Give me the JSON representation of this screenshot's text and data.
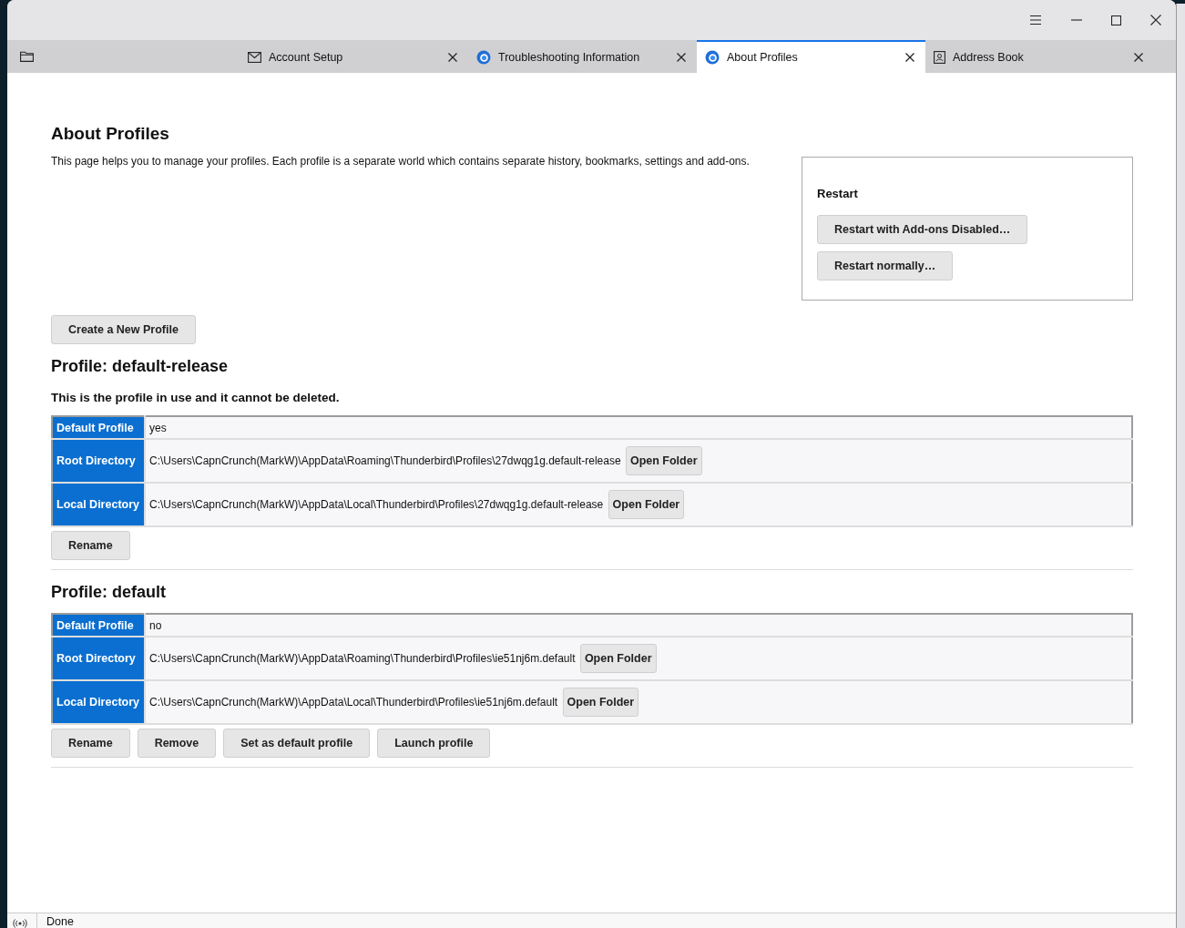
{
  "tabs": [
    {
      "label": "Account Setup",
      "kind": "mail",
      "selected": false
    },
    {
      "label": "Troubleshooting Information",
      "kind": "app",
      "selected": false
    },
    {
      "label": "About Profiles",
      "kind": "app",
      "selected": true
    },
    {
      "label": "Address Book",
      "kind": "contacts",
      "selected": false
    }
  ],
  "page": {
    "title": "About Profiles",
    "intro": "This page helps you to manage your profiles. Each profile is a separate world which contains separate history, bookmarks, settings and add-ons.",
    "restart": {
      "title": "Restart",
      "buttons": [
        "Restart with Add-ons Disabled…",
        "Restart normally…"
      ]
    },
    "create_button": "Create a New Profile",
    "profiles": [
      {
        "title": "Profile: default-release",
        "note": "This is the profile in use and it cannot be deleted.",
        "rows": [
          {
            "label": "Default Profile",
            "value": "yes"
          },
          {
            "label": "Root Directory",
            "value": "C:\\Users\\CapnCrunch(MarkW)\\AppData\\Roaming\\Thunderbird\\Profiles\\27dwqg1g.default-release",
            "button": "Open Folder"
          },
          {
            "label": "Local Directory",
            "value": "C:\\Users\\CapnCrunch(MarkW)\\AppData\\Local\\Thunderbird\\Profiles\\27dwqg1g.default-release",
            "button": "Open Folder"
          }
        ],
        "buttons": [
          "Rename"
        ]
      },
      {
        "title": "Profile: default",
        "rows": [
          {
            "label": "Default Profile",
            "value": "no"
          },
          {
            "label": "Root Directory",
            "value": "C:\\Users\\CapnCrunch(MarkW)\\AppData\\Roaming\\Thunderbird\\Profiles\\ie51nj6m.default",
            "button": "Open Folder"
          },
          {
            "label": "Local Directory",
            "value": "C:\\Users\\CapnCrunch(MarkW)\\AppData\\Local\\Thunderbird\\Profiles\\ie51nj6m.default",
            "button": "Open Folder"
          }
        ],
        "buttons": [
          "Rename",
          "Remove",
          "Set as default profile",
          "Launch profile"
        ]
      }
    ]
  },
  "status_bar": {
    "text": "Done"
  }
}
